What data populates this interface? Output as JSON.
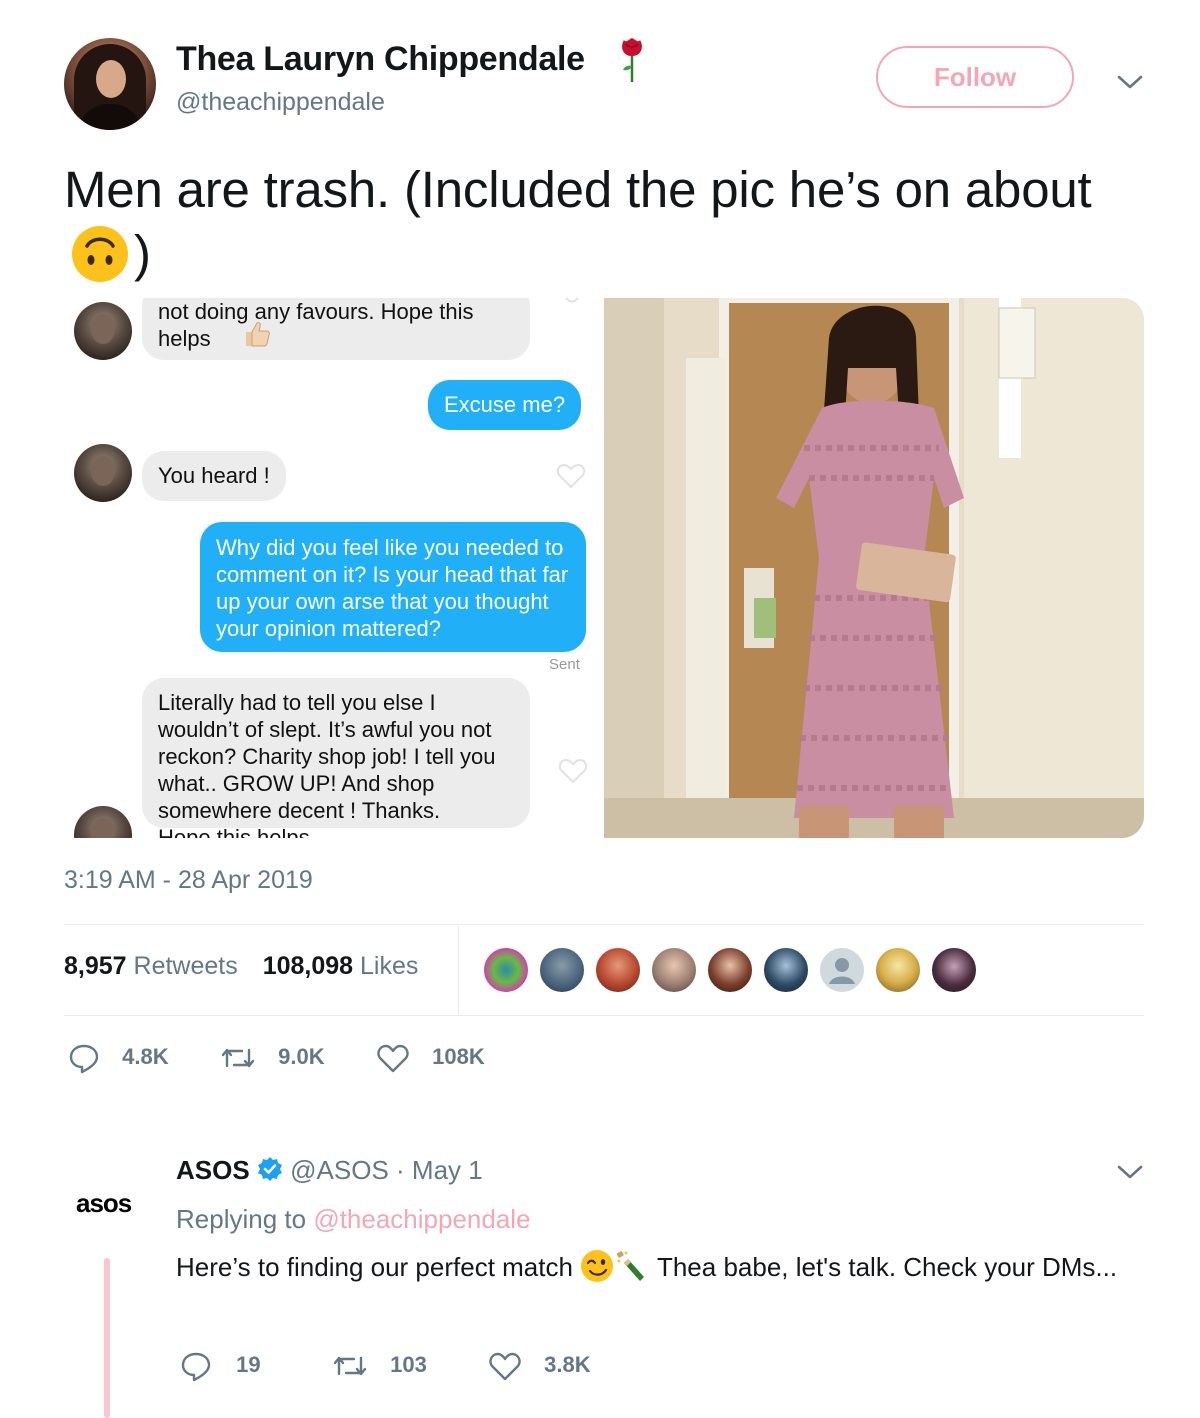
{
  "tweet": {
    "display_name": "Thea Lauryn Chippendale",
    "name_emoji": "rose-icon",
    "handle": "@theachippendale",
    "follow_label": "Follow",
    "text": "Men are trash. (Included the pic he’s on about",
    "text_emoji": "upside-down-face-icon",
    "text_close": ")",
    "timestamp": "3:19 AM - 28 Apr 2019",
    "retweets_count": "8,957",
    "retweets_label": "Retweets",
    "likes_count": "108,098",
    "likes_label": "Likes",
    "reply_count": "4.8K",
    "retweet_count_short": "9.0K",
    "like_count_short": "108K",
    "accent_color": "#f3a6b6"
  },
  "dm_screenshot": {
    "messages": [
      {
        "from": "them",
        "text": "not doing any favours. Hope this helps"
      },
      {
        "from": "me",
        "text": "Excuse me?"
      },
      {
        "from": "them",
        "text": "You heard !"
      },
      {
        "from": "me",
        "text": "Why did you feel like you needed to comment on it? Is your head that far up your own arse that you thought your opinion mattered?"
      },
      {
        "from": "me_status",
        "text": "Sent"
      },
      {
        "from": "them",
        "text": "Literally had to tell you else I wouldn’t of slept. It’s awful you not reckon? Charity shop job! I tell you what.. GROW UP! And shop somewhere decent ! Thanks."
      },
      {
        "from": "them_cut",
        "text": "Hope this helps"
      }
    ],
    "bubble_out_color": "#21b0f7",
    "bubble_in_color": "#ececec"
  },
  "reply": {
    "logo_text": "asos",
    "name": "ASOS",
    "handle_date": "@ASOS · May 1",
    "replying_prefix": "Replying to",
    "replying_handle": "@theachippendale",
    "text_part1": "Here’s to finding our perfect match",
    "text_part2": "Thea babe, let's talk. Check your DMs...",
    "reply_count": "19",
    "retweet_count": "103",
    "like_count": "3.8K"
  }
}
